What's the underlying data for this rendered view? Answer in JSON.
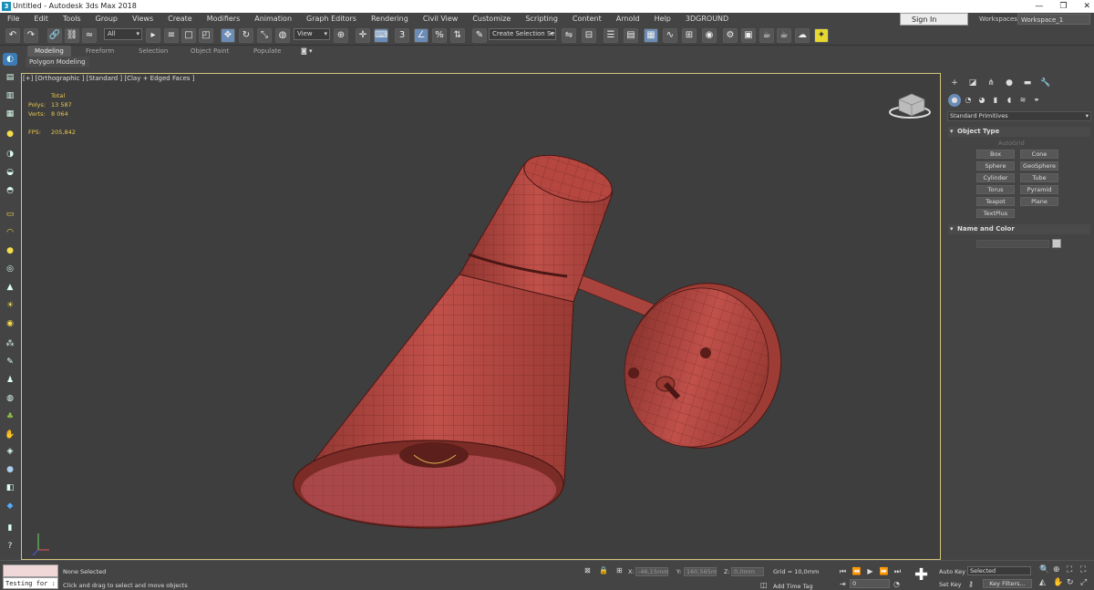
{
  "window": {
    "title": "Untitled - Autodesk 3ds Max 2018",
    "controls": [
      "—",
      "❐",
      "✕"
    ]
  },
  "menu": [
    "File",
    "Edit",
    "Tools",
    "Group",
    "Views",
    "Create",
    "Modifiers",
    "Animation",
    "Graph Editors",
    "Rendering",
    "Civil View",
    "Customize",
    "Scripting",
    "Content",
    "Arnold",
    "Help",
    "3DGROUND"
  ],
  "account": {
    "sign_in": "Sign In",
    "workspaces_label": "Workspaces:",
    "workspace": "Workspace_1"
  },
  "toolbar": {
    "filter": "All",
    "coord_system": "View",
    "selection_set": "Create Selection Se"
  },
  "ribbon": {
    "tabs": [
      "Modeling",
      "Freeform",
      "Selection",
      "Object Paint",
      "Populate"
    ],
    "sub_label": "Polygon Modeling"
  },
  "viewport": {
    "label": "[+] [Orthographic ] [Standard ] [Clay + Edged Faces ]",
    "stats": {
      "header": "Total",
      "polys_label": "Polys:",
      "polys": "13 587",
      "verts_label": "Verts:",
      "verts": "8 064",
      "fps_label": "FPS:",
      "fps": "205,842"
    },
    "model_color": "#b7473f"
  },
  "command_panel": {
    "category": "Standard Primitives",
    "object_type_title": "Object Type",
    "autogrid": "AutoGrid",
    "primitives": [
      "Box",
      "Cone",
      "Sphere",
      "GeoSphere",
      "Cylinder",
      "Tube",
      "Torus",
      "Pyramid",
      "Teapot",
      "Plane",
      "TextPlus"
    ],
    "name_color_title": "Name and Color"
  },
  "status": {
    "selection": "None Selected",
    "prompt": "Click and drag to select and move objects",
    "script_text": "Testing for :",
    "x_label": "X:",
    "x": "-46,15mm",
    "y_label": "Y:",
    "y": "160,565m",
    "z_label": "Z:",
    "z": "0,0mm",
    "grid": "Grid = 10,0mm",
    "add_time_tag": "Add Time Tag",
    "auto_key": "Auto Key",
    "set_key": "Set Key",
    "key_mode": "Selected",
    "key_filters": "Key Filters...",
    "frame": "0"
  }
}
